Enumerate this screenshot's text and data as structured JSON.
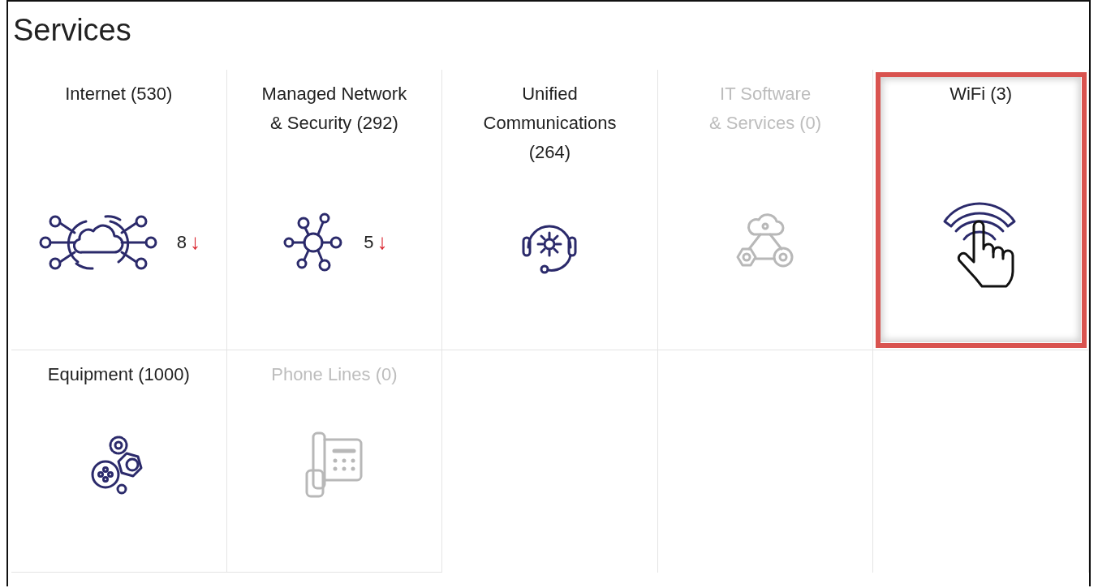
{
  "title": "Services",
  "tiles": [
    {
      "label": "Internet (530)",
      "kind": "internet",
      "disabled": false,
      "highlighted": false,
      "alert": {
        "count": "8",
        "arrow": "↓"
      }
    },
    {
      "label": "Managed Network\n& Security (292)",
      "kind": "network",
      "disabled": false,
      "highlighted": false,
      "alert": {
        "count": "5",
        "arrow": "↓"
      }
    },
    {
      "label": "Unified\nCommunications\n(264)",
      "kind": "communications",
      "disabled": false,
      "highlighted": false
    },
    {
      "label": "IT Software\n& Services (0)",
      "kind": "software",
      "disabled": true,
      "highlighted": false
    },
    {
      "label": "WiFi (3)",
      "kind": "wifi",
      "disabled": false,
      "highlighted": true
    },
    {
      "label": "Equipment (1000)",
      "kind": "equipment",
      "disabled": false,
      "highlighted": false
    },
    {
      "label": "Phone Lines (0)",
      "kind": "phone",
      "disabled": true,
      "highlighted": false
    }
  ]
}
